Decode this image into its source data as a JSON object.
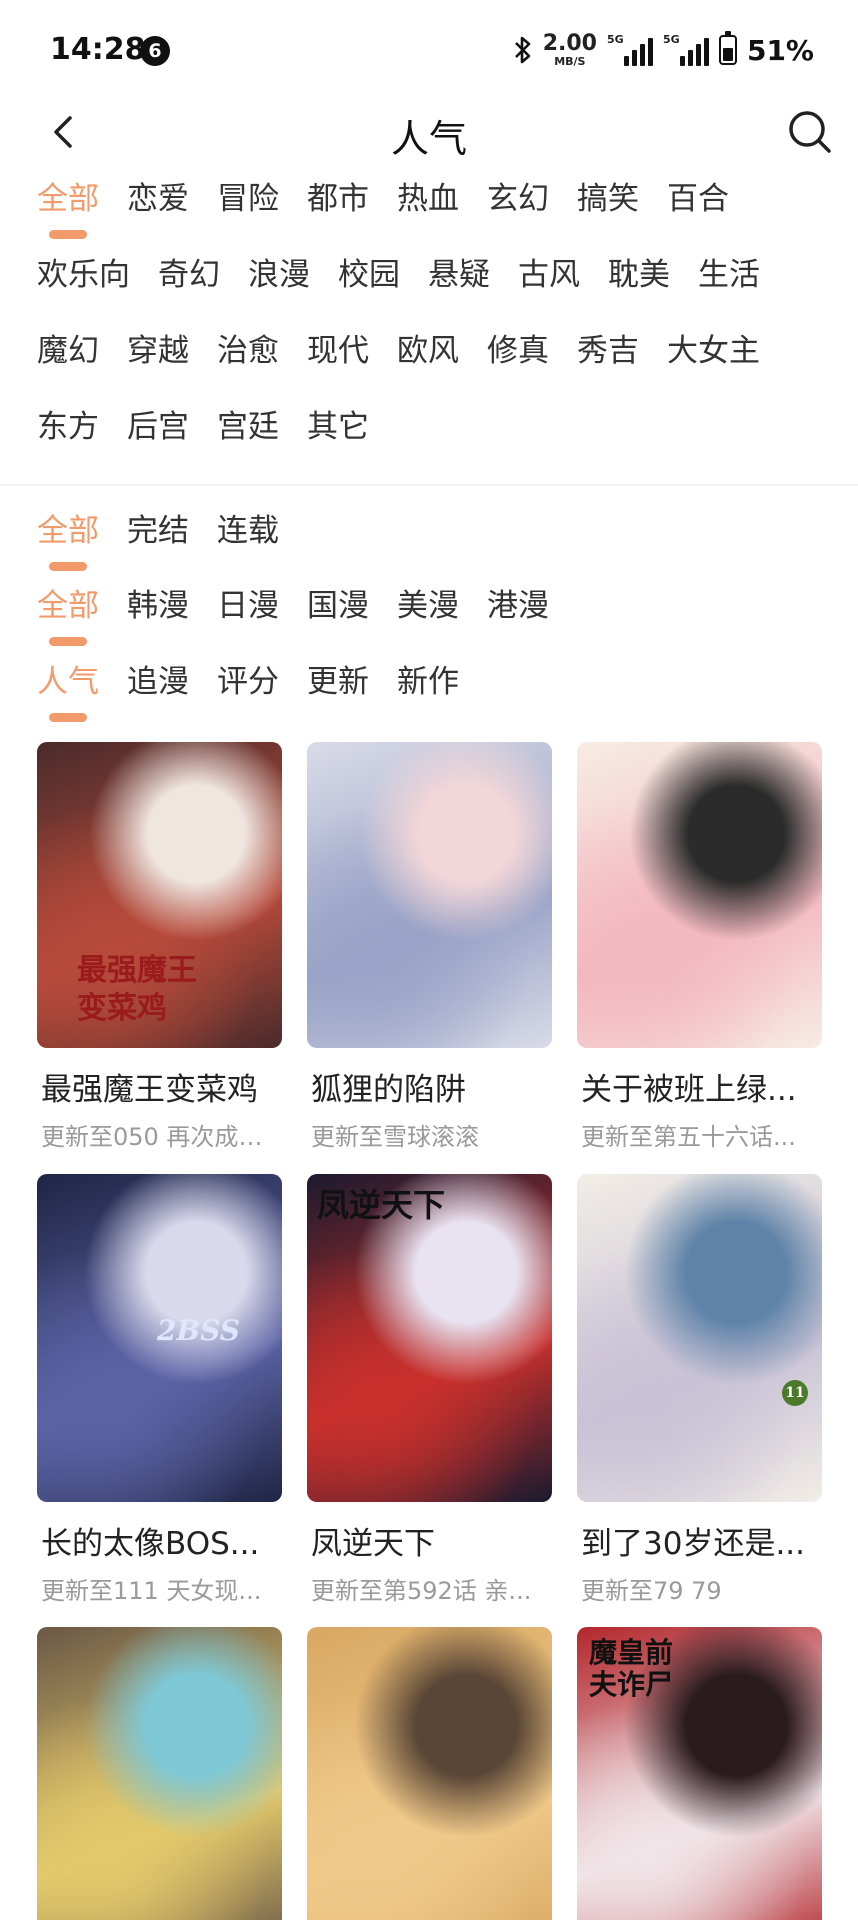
{
  "status_bar": {
    "time": "14:28",
    "notification_count": "6",
    "net_speed_value": "2.00",
    "net_speed_unit": "MB/S",
    "sim1_label": "5G",
    "sim2_label": "5G",
    "battery_percent": "51%",
    "battery_level": 0.51
  },
  "header": {
    "title": "人气",
    "back_icon": "chevron-left-icon",
    "search_icon": "search-icon"
  },
  "genre_filter": {
    "rows": [
      [
        "全部",
        "恋爱",
        "冒险",
        "都市",
        "热血",
        "玄幻",
        "搞笑",
        "百合"
      ],
      [
        "欢乐向",
        "奇幻",
        "浪漫",
        "校园",
        "悬疑",
        "古风",
        "耽美",
        "生活"
      ],
      [
        "魔幻",
        "穿越",
        "治愈",
        "现代",
        "欧风",
        "修真",
        "秀吉",
        "大女主"
      ],
      [
        "东方",
        "后宫",
        "宫廷",
        "其它"
      ]
    ],
    "selected": "全部"
  },
  "status_filter": {
    "options": [
      "全部",
      "完结",
      "连载"
    ],
    "selected": "全部"
  },
  "region_filter": {
    "options": [
      "全部",
      "韩漫",
      "日漫",
      "国漫",
      "美漫",
      "港漫"
    ],
    "selected": "全部"
  },
  "sort_filter": {
    "options": [
      "人气",
      "追漫",
      "评分",
      "更新",
      "新作"
    ],
    "selected": "人气"
  },
  "accent_color": "#f29a6a",
  "comics": [
    {
      "title": "最强魔王变菜鸡",
      "subtitle": "更新至050 再次成为...",
      "cover_text": "最强魔王变菜鸡",
      "colors": [
        "#4a2b2b",
        "#b74a3a",
        "#f0e6e0"
      ]
    },
    {
      "title": "狐狸的陷阱",
      "subtitle": "更新至雪球滚滚",
      "cover_text": "",
      "colors": [
        "#d9dbe8",
        "#9aa3c7",
        "#f2d6d8"
      ]
    },
    {
      "title": "关于被班上绿...",
      "subtitle": "更新至第五十六话...",
      "cover_text": "",
      "colors": [
        "#f7ece4",
        "#f3b8c0",
        "#2b2b2b"
      ]
    },
    {
      "title": "长的太像BOS...",
      "subtitle": "更新至111 天女现...",
      "cover_text": "2BSS",
      "colors": [
        "#1f2544",
        "#5b63a5",
        "#d9d8ec"
      ]
    },
    {
      "title": "凤逆天下",
      "subtitle": "更新至第592话 亲...",
      "cover_text": "凤逆天下",
      "colors": [
        "#1b1a2e",
        "#c9302c",
        "#e9e2f0"
      ]
    },
    {
      "title": "到了30岁还是...",
      "subtitle": "更新至79 79",
      "cover_text": "11",
      "colors": [
        "#f1ede6",
        "#c9c2d6",
        "#5f83a8"
      ]
    },
    {
      "title": "",
      "subtitle": "",
      "cover_text": "",
      "colors": [
        "#6b5846",
        "#e3c96b",
        "#7ec8d6"
      ]
    },
    {
      "title": "",
      "subtitle": "",
      "cover_text": "",
      "colors": [
        "#d9a862",
        "#f0c98a",
        "#5a4636"
      ]
    },
    {
      "title": "",
      "subtitle": "",
      "cover_text": "魔皇前夫诈尸",
      "colors": [
        "#b3262b",
        "#f0e4e8",
        "#2a1b1f"
      ]
    }
  ]
}
